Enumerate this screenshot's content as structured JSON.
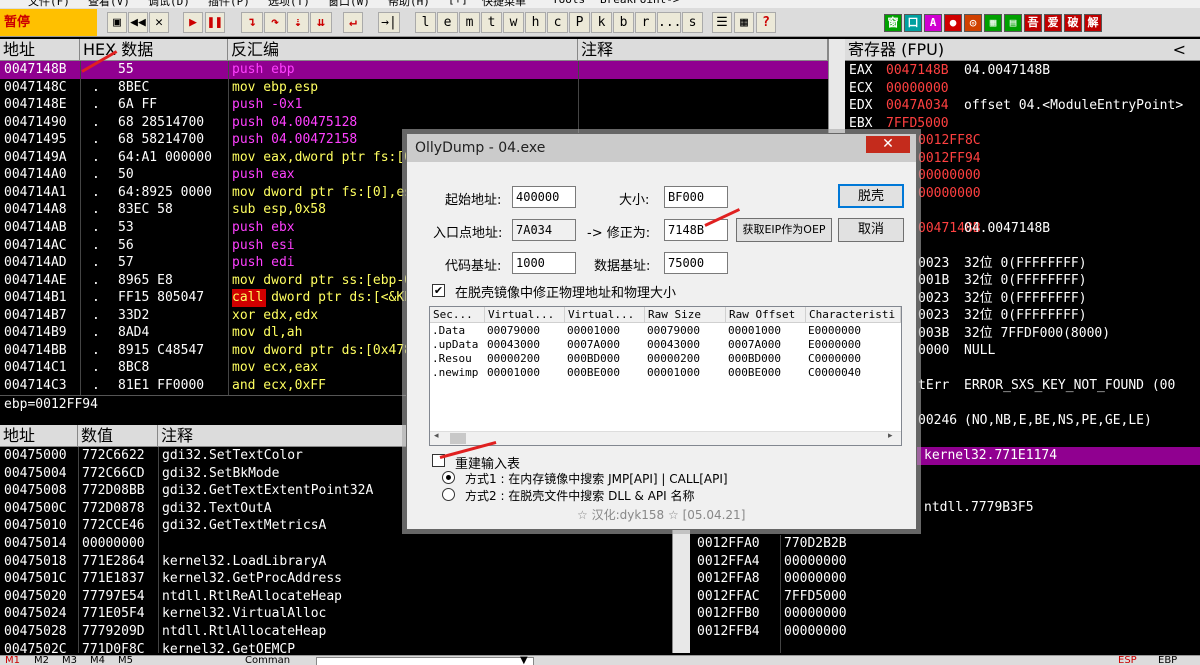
{
  "menu": [
    "文件(F)",
    "查看(V)",
    "调试(D)",
    "插件(P)",
    "选项(T)",
    "窗口(W)",
    "帮助(H)",
    "[+]",
    "快捷菜单",
    "Tools",
    "BreakPoint->"
  ],
  "status_label": "暂停",
  "toolbar_letters": [
    "l",
    "e",
    "m",
    "t",
    "w",
    "h",
    "c",
    "P",
    "k",
    "b",
    "r",
    "...",
    "s"
  ],
  "toolbar_right": [
    "窗",
    "口",
    "A",
    "●",
    "◎",
    "▦",
    "▤",
    "吾",
    "爱",
    "破",
    "解"
  ],
  "cpu": {
    "headers": {
      "addr": "地址",
      "hex": "HEX 数据",
      "disasm": "反汇编",
      "comment": "注释"
    },
    "rows": [
      {
        "addr": "0047148B",
        "mark": "",
        "hex": "55",
        "asm": "push ebp"
      },
      {
        "addr": "0047148C",
        "mark": ".",
        "hex": "8BEC",
        "asm": "mov ebp,esp"
      },
      {
        "addr": "0047148E",
        "mark": ".",
        "hex": "6A FF",
        "asm": "push -0x1"
      },
      {
        "addr": "00471490",
        "mark": ".",
        "hex": "68 28514700",
        "asm": "push 04.00475128"
      },
      {
        "addr": "00471495",
        "mark": ".",
        "hex": "68 58214700",
        "asm": "push 04.00472158"
      },
      {
        "addr": "0047149A",
        "mark": ".",
        "hex": "64:A1 000000",
        "asm": "mov eax,dword ptr fs:[0]"
      },
      {
        "addr": "004714A0",
        "mark": ".",
        "hex": "50",
        "asm": "push eax"
      },
      {
        "addr": "004714A1",
        "mark": ".",
        "hex": "64:8925 0000",
        "asm": "mov dword ptr fs:[0],esp"
      },
      {
        "addr": "004714A8",
        "mark": ".",
        "hex": "83EC 58",
        "asm": "sub esp,0x58"
      },
      {
        "addr": "004714AB",
        "mark": ".",
        "hex": "53",
        "asm": "push ebx"
      },
      {
        "addr": "004714AC",
        "mark": ".",
        "hex": "56",
        "asm": "push esi"
      },
      {
        "addr": "004714AD",
        "mark": ".",
        "hex": "57",
        "asm": "push edi"
      },
      {
        "addr": "004714AE",
        "mark": ".",
        "hex": "8965 E8",
        "asm": "mov dword ptr ss:[ebp-0x18],esp"
      },
      {
        "addr": "004714B1",
        "mark": ".",
        "hex": "FF15 805047",
        "asm": "call dword ptr ds:[<&KERNEL32.GetVersion>]"
      },
      {
        "addr": "004714B7",
        "mark": ".",
        "hex": "33D2",
        "asm": "xor edx,edx"
      },
      {
        "addr": "004714B9",
        "mark": ".",
        "hex": "8AD4",
        "asm": "mov dl,ah"
      },
      {
        "addr": "004714BB",
        "mark": ".",
        "hex": "8915 C48547",
        "asm": "mov dword ptr ds:[0x4785C4],edx"
      },
      {
        "addr": "004714C1",
        "mark": ".",
        "hex": "8BC8",
        "asm": "mov ecx,eax"
      },
      {
        "addr": "004714C3",
        "mark": ".",
        "hex": "81E1 FF0000",
        "asm": "and ecx,0xFF"
      }
    ],
    "info": "ebp=0012FF94"
  },
  "registers": {
    "title": "寄存器 (FPU)",
    "collapse": "<",
    "lines": [
      {
        "name": "EAX",
        "val": "0047148B",
        "extra": "04.0047148B"
      },
      {
        "name": "ECX",
        "val": "00000000",
        "extra": ""
      },
      {
        "name": "EDX",
        "val": "0047A034",
        "extra": "offset 04.<ModuleEntryPoint>"
      },
      {
        "name": "EBX",
        "val": "7FFD5000",
        "extra": ""
      },
      {
        "name": "",
        "val": "0012FF8C",
        "extra": ""
      },
      {
        "name": "",
        "val": "0012FF94",
        "extra": ""
      },
      {
        "name": "",
        "val": "00000000",
        "extra": ""
      },
      {
        "name": "",
        "val": "00000000",
        "extra": ""
      },
      {
        "name": "",
        "val": "",
        "extra": ""
      },
      {
        "name": "",
        "val": "0047148B",
        "extra": "04.0047148B"
      },
      {
        "name": "",
        "val": "",
        "extra": ""
      },
      {
        "name": "",
        "val": "0023",
        "extra": "32位 0(FFFFFFFF)"
      },
      {
        "name": "",
        "val": "001B",
        "extra": "32位 0(FFFFFFFF)"
      },
      {
        "name": "",
        "val": "0023",
        "extra": "32位 0(FFFFFFFF)"
      },
      {
        "name": "",
        "val": "0023",
        "extra": "32位 0(FFFFFFFF)"
      },
      {
        "name": "",
        "val": "003B",
        "extra": "32位 7FFDF000(8000)"
      },
      {
        "name": "",
        "val": "0000",
        "extra": "NULL"
      },
      {
        "name": "",
        "val": "",
        "extra": ""
      },
      {
        "name": "",
        "val": "tErr",
        "extra": "ERROR_SXS_KEY_NOT_FOUND (00"
      },
      {
        "name": "",
        "val": "",
        "extra": ""
      },
      {
        "name": "",
        "val": "00246",
        "extra": "(NO,NB,E,BE,NS,PE,GE,LE)"
      },
      {
        "name": "",
        "val": "",
        "extra": ""
      },
      {
        "name": "",
        "val": "0 0.0",
        "extra": ""
      }
    ]
  },
  "dump": {
    "headers": {
      "addr": "地址",
      "val": "数值",
      "comment": "注释"
    },
    "rows": [
      {
        "addr": "00475000",
        "val": "772C6622",
        "comment": "gdi32.SetTextColor"
      },
      {
        "addr": "00475004",
        "val": "772C66CD",
        "comment": "gdi32.SetBkMode"
      },
      {
        "addr": "00475008",
        "val": "772D08BB",
        "comment": "gdi32.GetTextExtentPoint32A"
      },
      {
        "addr": "0047500C",
        "val": "772D0878",
        "comment": "gdi32.TextOutA"
      },
      {
        "addr": "00475010",
        "val": "772CCE46",
        "comment": "gdi32.GetTextMetricsA"
      },
      {
        "addr": "00475014",
        "val": "00000000",
        "comment": ""
      },
      {
        "addr": "00475018",
        "val": "771E2864",
        "comment": "kernel32.LoadLibraryA"
      },
      {
        "addr": "0047501C",
        "val": "771E1837",
        "comment": "kernel32.GetProcAddress"
      },
      {
        "addr": "00475020",
        "val": "77797E54",
        "comment": "ntdll.RtlReAllocateHeap"
      },
      {
        "addr": "00475024",
        "val": "771E05F4",
        "comment": "kernel32.VirtualAlloc"
      },
      {
        "addr": "00475028",
        "val": "7779209D",
        "comment": "ntdll.RtlAllocateHeap"
      },
      {
        "addr": "0047502C",
        "val": "771D0F8C",
        "comment": "kernel32.GetOEMCP"
      }
    ]
  },
  "stack": {
    "top_comments": [
      "kernel32.771E1174",
      "",
      "",
      "ntdll.7779B3F5"
    ],
    "rows": [
      {
        "addr": "0012FFA0",
        "val": "770D2B2B"
      },
      {
        "addr": "0012FFA4",
        "val": "00000000"
      },
      {
        "addr": "0012FFA8",
        "val": "00000000"
      },
      {
        "addr": "0012FFAC",
        "val": "7FFD5000"
      },
      {
        "addr": "0012FFB0",
        "val": "00000000"
      },
      {
        "addr": "0012FFB4",
        "val": "00000000"
      }
    ]
  },
  "dialog": {
    "title": "OllyDump - 04.exe",
    "close": "✕",
    "start_label": "起始地址:",
    "start_value": "400000",
    "size_label": "大小:",
    "size_value": "BF000",
    "dump_btn": "脱壳",
    "entry_label": "入口点地址:",
    "entry_value": "7A034",
    "fix_label": "-> 修正为:",
    "fix_value": "7148B",
    "eip_btn": "获取EIP作为OEP",
    "cancel_btn": "取消",
    "code_base_label": "代码基址:",
    "code_base_value": "1000",
    "data_base_label": "数据基址:",
    "data_base_value": "75000",
    "fix_raw_label": "在脱壳镜像中修正物理地址和物理大小",
    "fix_raw_check": "✔",
    "sections": {
      "headers": [
        "Sec...",
        "Virtual...",
        "Virtual...",
        "Raw Size",
        "Raw Offset",
        "Characteristi"
      ],
      "rows": [
        [
          ".Data",
          "00079000",
          "00001000",
          "00079000",
          "00001000",
          "E0000000"
        ],
        [
          ".upData",
          "00043000",
          "0007A000",
          "00043000",
          "0007A000",
          "E0000000"
        ],
        [
          ".Resou",
          "00000200",
          "000BD000",
          "00000200",
          "000BD000",
          "C0000000"
        ],
        [
          ".newimp",
          "00001000",
          "000BE000",
          "00001000",
          "000BE000",
          "C0000040"
        ]
      ]
    },
    "rebuild_label": "重建输入表",
    "method1": "方式1 : 在内存镜像中搜索 JMP[API] | CALL[API]",
    "method2": "方式2 : 在脱壳文件中搜索 DLL & API 名称",
    "credit": "☆ 汉化:dyk158 ☆ [05.04.21]"
  },
  "bottom": [
    "M1",
    "M2",
    "M3",
    "M4",
    "M5",
    "Comman",
    "▼",
    "ESP",
    "EBP"
  ]
}
